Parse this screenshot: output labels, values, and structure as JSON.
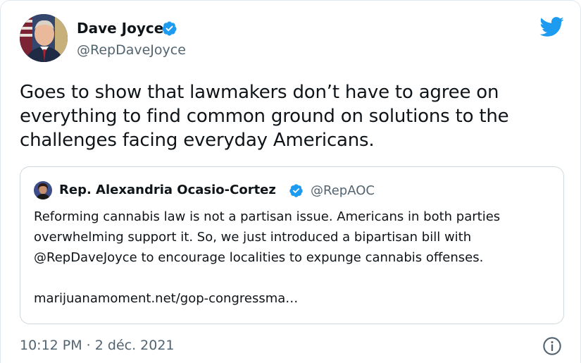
{
  "author": {
    "name": "Dave Joyce",
    "handle": "@RepDaveJoyce",
    "verified": true
  },
  "tweet": {
    "text": "Goes to show that lawmakers don’t have to agree on everything to find common ground on solutions to the challenges facing everyday Americans."
  },
  "quoted": {
    "name": "Rep. Alexandria Ocasio-Cortez",
    "handle": "@RepAOC",
    "verified": true,
    "text": "Reforming cannabis law is not a partisan issue. Americans in both parties overwhelming support it. So, we just introduced a bipartisan bill with @RepDaveJoyce to encourage localities to expunge cannabis offenses.",
    "link": "marijuanamoment.net/gop-congressma…"
  },
  "meta": {
    "timestamp": "10:12 PM · 2 déc. 2021"
  },
  "icons": {
    "verified": "verified-badge-icon",
    "brand": "twitter-bird-icon",
    "info": "info-icon"
  },
  "colors": {
    "brand_blue": "#1d9bf0",
    "text_primary": "#0f1419",
    "text_secondary": "#536471",
    "border": "#cfd9de"
  }
}
